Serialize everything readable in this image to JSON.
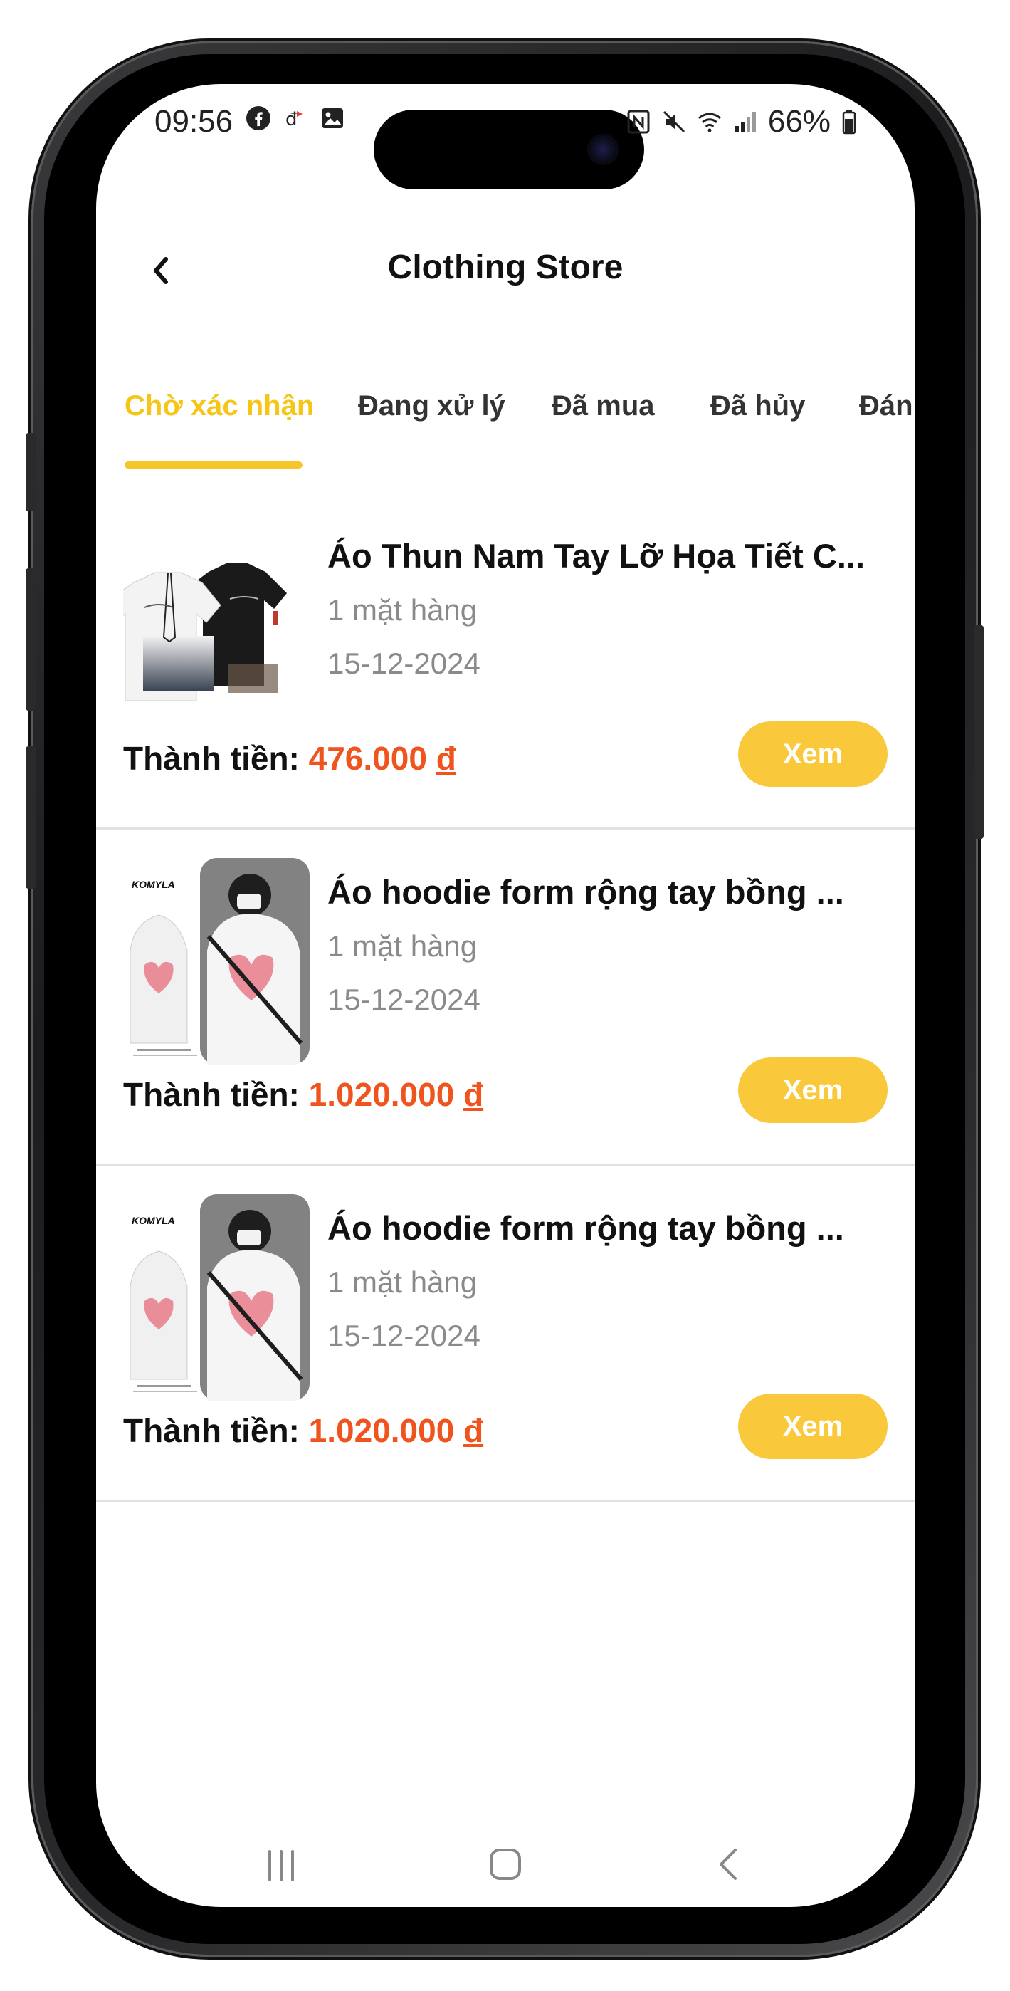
{
  "status_bar": {
    "time": "09:56",
    "battery": "66%",
    "left_icons": [
      "facebook-icon",
      "app-notification-icon",
      "gallery-icon"
    ],
    "right_icons": [
      "nfc-icon",
      "mute-icon",
      "wifi-icon",
      "signal-icon",
      "battery-icon"
    ]
  },
  "header": {
    "title": "Clothing Store",
    "back_icon": "chevron-left-icon"
  },
  "tabs": [
    {
      "label": "Chờ xác nhận",
      "active": true
    },
    {
      "label": "Đang xử lý",
      "active": false
    },
    {
      "label": "Đã mua",
      "active": false
    },
    {
      "label": "Đã hủy",
      "active": false
    },
    {
      "label": "Đánh",
      "active": false
    }
  ],
  "orders": [
    {
      "name": "Áo Thun Nam Tay Lỡ Họa Tiết C...",
      "quantity": "1 mặt hàng",
      "date": "15-12-2024",
      "total_label": "Thành tiền: ",
      "total_value": "476.000",
      "currency": "đ",
      "button_label": "Xem",
      "image": "tshirt-product-image"
    },
    {
      "name": "Áo hoodie form rộng tay bồng ...",
      "quantity": "1 mặt hàng",
      "date": "15-12-2024",
      "total_label": "Thành tiền: ",
      "total_value": "1.020.000",
      "currency": "đ",
      "button_label": "Xem",
      "image": "hoodie-product-image",
      "brand_text": "KOMYLA"
    },
    {
      "name": "Áo hoodie form rộng tay bồng ...",
      "quantity": "1 mặt hàng",
      "date": "15-12-2024",
      "total_label": "Thành tiền: ",
      "total_value": "1.020.000",
      "currency": "đ",
      "button_label": "Xem",
      "image": "hoodie-product-image",
      "brand_text": "KOMYLA"
    }
  ],
  "nav_bar": {
    "items": [
      "recent-apps-icon",
      "home-icon",
      "back-icon"
    ]
  },
  "colors": {
    "accent": "#f5c518",
    "button": "#f9c93b",
    "price": "#f0541e",
    "muted_text": "#8a8a8a"
  }
}
